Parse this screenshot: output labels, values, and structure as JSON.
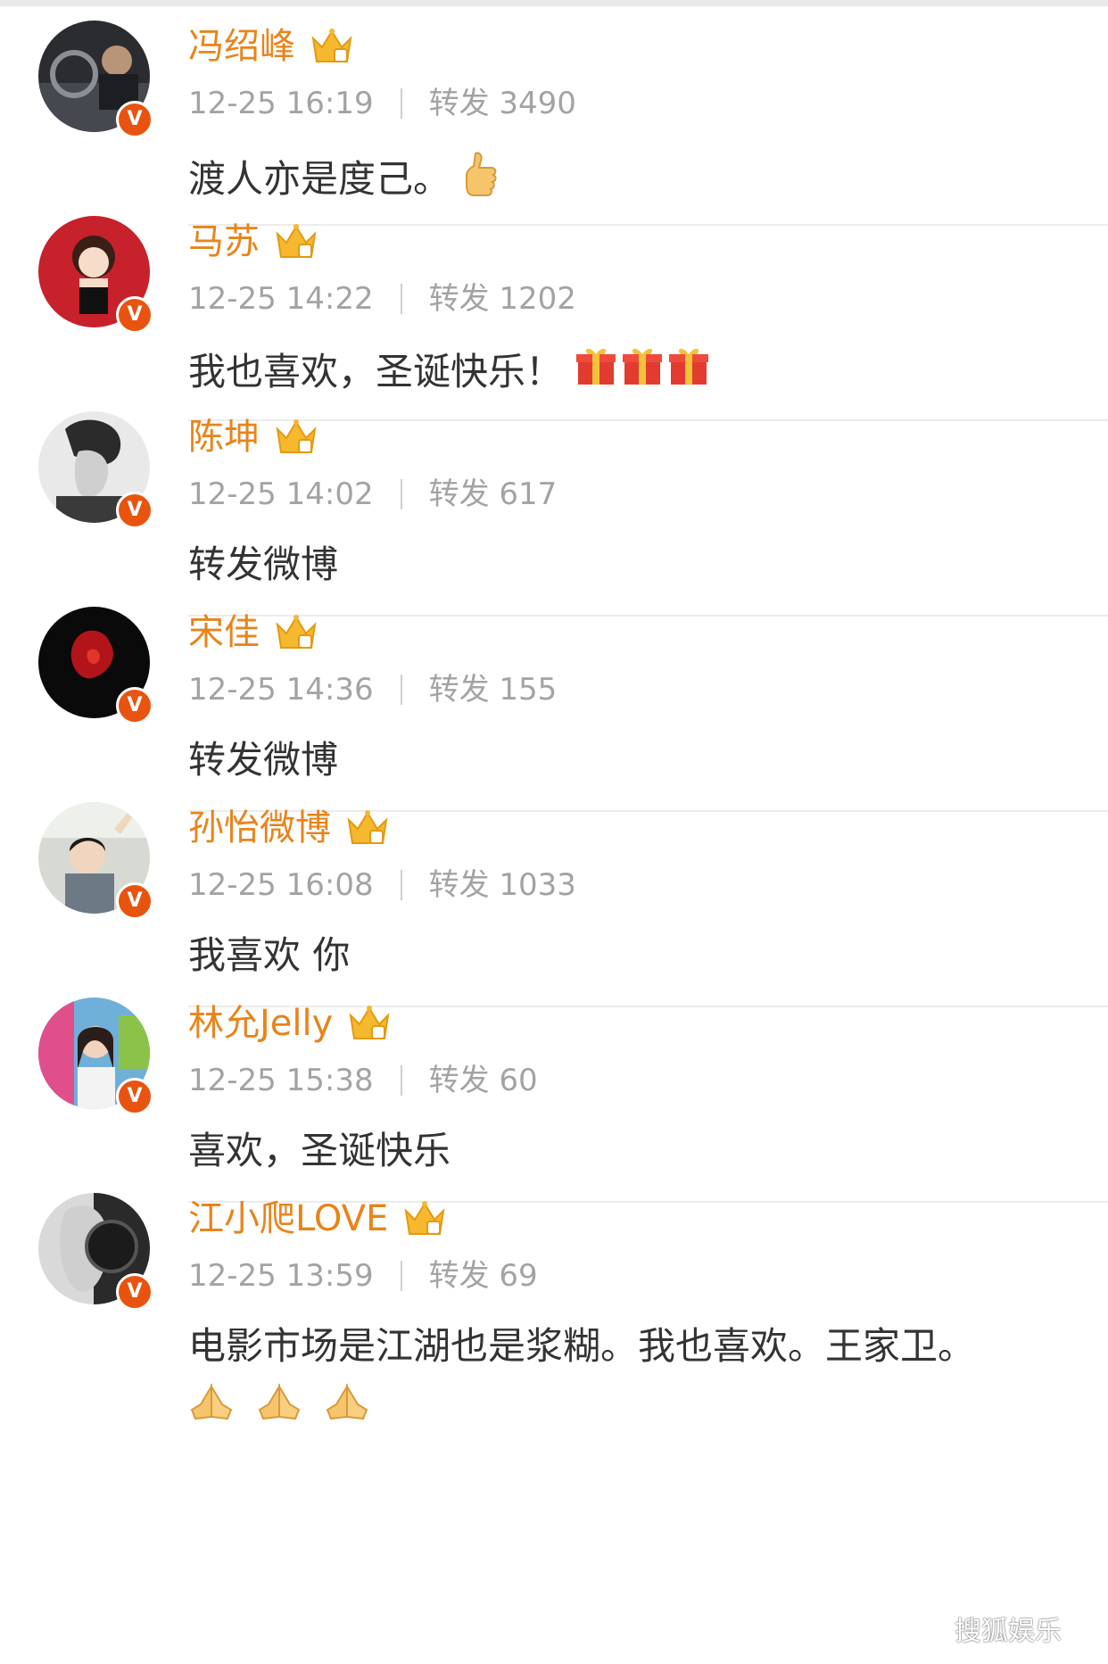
{
  "posts": [
    {
      "name": "冯绍峰",
      "time": "12-25 16:19",
      "repost": "转发 3490",
      "text": "渡人亦是度己。",
      "emoji": "thumbs-up",
      "emoji_count": 1
    },
    {
      "name": "马苏",
      "time": "12-25 14:22",
      "repost": "转发 1202",
      "text": "我也喜欢，圣诞快乐！",
      "emoji": "gift",
      "emoji_count": 3
    },
    {
      "name": "陈坤",
      "time": "12-25 14:02",
      "repost": "转发 617",
      "text": "转发微博"
    },
    {
      "name": "宋佳",
      "time": "12-25 14:36",
      "repost": "转发 155",
      "text": "转发微博"
    },
    {
      "name": "孙怡微博",
      "time": "12-25 16:08",
      "repost": "转发 1033",
      "text": "我喜欢 你"
    },
    {
      "name": "林允Jelly",
      "time": "12-25 15:38",
      "repost": "转发 60",
      "text": "喜欢，圣诞快乐"
    },
    {
      "name": "江小爬LOVE",
      "time": "12-25 13:59",
      "repost": "转发 69",
      "text": "电影市场是江湖也是浆糊。我也喜欢。王家卫。",
      "emoji": "praying-hands",
      "emoji_count": 3
    }
  ],
  "badge": {
    "verified_letter": "V"
  },
  "watermark": {
    "text": "搜狐娱乐"
  },
  "colors": {
    "name": "#e8841a",
    "meta": "#a3a3a3",
    "text": "#333333",
    "badge": "#e8540f",
    "crown": "#f5b82e"
  }
}
